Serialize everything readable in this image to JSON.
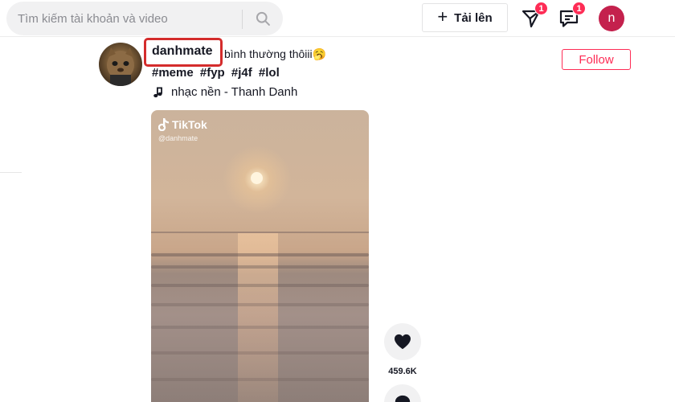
{
  "search": {
    "placeholder": "Tìm kiếm tài khoản và video",
    "value": ""
  },
  "header": {
    "upload_label": "Tải lên",
    "inbox_badge": "1",
    "messages_badge": "1",
    "user_initial": "n",
    "avatar_color": "#c4214d"
  },
  "post": {
    "username": "danhmate",
    "caption": "bình thường thôiii🥱",
    "hashtags": [
      "#meme",
      "#fyp",
      "#j4f",
      "#lol"
    ],
    "music": "nhạc nền - Thanh Danh",
    "follow_label": "Follow",
    "video": {
      "watermark_brand": "TikTok",
      "watermark_handle": "@danhmate"
    },
    "likes": "459.6K"
  },
  "colors": {
    "accent": "#fe2c55",
    "highlight": "#d42c2c",
    "text": "#161823"
  }
}
